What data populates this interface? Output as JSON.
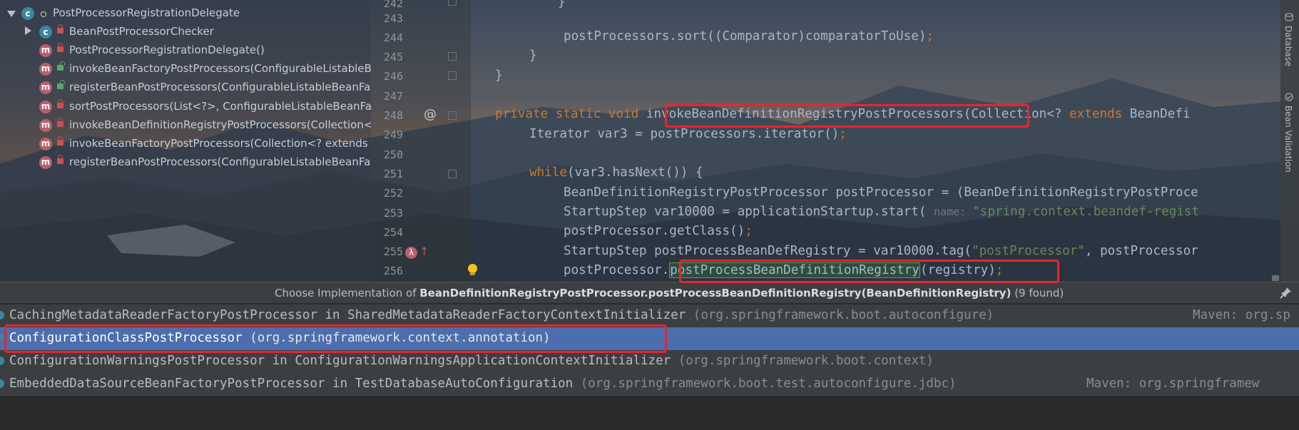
{
  "structure": {
    "root": {
      "label": "PostProcessorRegistrationDelegate",
      "icon": "class-icon"
    },
    "items": [
      {
        "label": "BeanPostProcessorChecker",
        "kind": "class",
        "visibility": "private"
      },
      {
        "label": "PostProcessorRegistrationDelegate()",
        "kind": "method",
        "visibility": "private"
      },
      {
        "label": "invokeBeanFactoryPostProcessors(ConfigurableListableBea",
        "kind": "method",
        "visibility": "public"
      },
      {
        "label": "registerBeanPostProcessors(ConfigurableListableBeanFact",
        "kind": "method",
        "visibility": "public"
      },
      {
        "label": "sortPostProcessors(List<?>, ConfigurableListableBeanFact",
        "kind": "method",
        "visibility": "private"
      },
      {
        "label": "invokeBeanDefinitionRegistryPostProcessors(Collection<?",
        "kind": "method",
        "visibility": "private"
      },
      {
        "label": "invokeBeanFactoryPostProcessors(Collection<? extends Be",
        "kind": "method",
        "visibility": "private"
      },
      {
        "label": "registerBeanPostProcessors(ConfigurableListableBeanFact",
        "kind": "method",
        "visibility": "private"
      }
    ]
  },
  "editor": {
    "lines": [
      {
        "num": "242",
        "code": "}"
      },
      {
        "num": "243",
        "code": ""
      },
      {
        "num": "244",
        "code": "postProcessors.sort((Comparator)comparatorToUse);"
      },
      {
        "num": "245",
        "code": "}"
      },
      {
        "num": "246",
        "code": "}"
      },
      {
        "num": "247",
        "code": ""
      },
      {
        "num": "248",
        "code": "private static void invokeBeanDefinitionRegistryPostProcessors(Collection<? extends BeanDefi"
      },
      {
        "num": "249",
        "code": "Iterator var3 = postProcessors.iterator();"
      },
      {
        "num": "250",
        "code": ""
      },
      {
        "num": "251",
        "code": "while(var3.hasNext()) {"
      },
      {
        "num": "252",
        "code": "BeanDefinitionRegistryPostProcessor postProcessor = (BeanDefinitionRegistryPostProce"
      },
      {
        "num": "253",
        "code": "StartupStep var10000 = applicationStartup.start( name: \"spring.context.beandef-regist"
      },
      {
        "num": "254",
        "code": "postProcessor.getClass();"
      },
      {
        "num": "255",
        "code": "StartupStep postProcessBeanDefRegistry = var10000.tag(\"postProcessor\", postProcessor"
      },
      {
        "num": "256",
        "code": "postProcessor.postProcessBeanDefinitionRegistry(registry);"
      }
    ],
    "tokens": {
      "l244": "postProcessors.sort((Comparator)comparatorToUse)",
      "semicolon": ";",
      "l248_kw": "private static void ",
      "l248_method": "invokeBeanDefinitionRegistryPostProcessors",
      "l248_a": "(Collection<? ",
      "l248_extends": "extends",
      "l248_b": " BeanDefi",
      "l249": "Iterator var3 = postProcessors.iterator()",
      "l251_kw": "while",
      "l251_rest": "(var3.hasNext()) {",
      "l252": "BeanDefinitionRegistryPostProcessor postProcessor = (BeanDefinitionRegistryPostProce",
      "l253_a": "StartupStep var10000 = applicationStartup.start( ",
      "l253_hint": "name: ",
      "l253_str": "\"spring.context.beandef-regist",
      "l254": "postProcessor.getClass()",
      "l255_a": "StartupStep postProcessBeanDefRegistry = var10000.tag(",
      "l255_str": "\"postProcessor\"",
      "l255_b": ", postProcessor",
      "l256_a": "postProcessor.",
      "l256_method": "postProcessBeanDefinitionRegistry",
      "l256_b": "(registry)",
      "brace": "}",
      "at_symbol": "@"
    }
  },
  "right_tabs": [
    "Database",
    "Bean Validation"
  ],
  "popup": {
    "title_prefix": "Choose Implementation of ",
    "title_bold": "BeanDefinitionRegistryPostProcessor.postProcessBeanDefinitionRegistry(BeanDefinitionRegistry)",
    "title_suffix": " (9 found)",
    "rows": [
      {
        "main": "CachingMetadataReaderFactoryPostProcessor in SharedMetadataReaderFactoryContextInitializer ",
        "pkg": "(org.springframework.boot.autoconfigure)",
        "maven": "Maven: org.sp",
        "selected": false
      },
      {
        "main": "ConfigurationClassPostProcessor ",
        "pkg": "(org.springframework.context.annotation)",
        "maven": "",
        "selected": true
      },
      {
        "main": "ConfigurationWarningsPostProcessor in ConfigurationWarningsApplicationContextInitializer ",
        "pkg": "(org.springframework.boot.context)",
        "maven": "",
        "selected": false
      },
      {
        "main": "EmbeddedDataSourceBeanFactoryPostProcessor in TestDatabaseAutoConfiguration ",
        "pkg": "(org.springframework.boot.test.autoconfigure.jdbc)",
        "maven": "Maven: org.springframew",
        "selected": false
      }
    ]
  },
  "colors": {
    "keyword": "#cc7832",
    "string": "#6a8759",
    "default_code": "#a9b7c6",
    "selection": "#4b6eaf",
    "annotation_red": "#e8252a"
  }
}
